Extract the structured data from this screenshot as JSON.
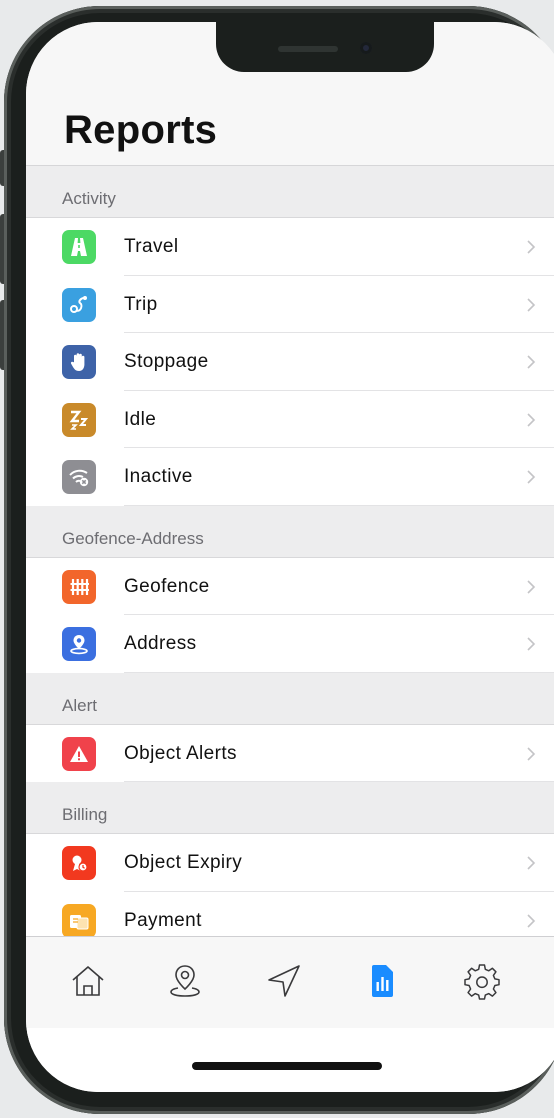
{
  "page": {
    "title": "Reports"
  },
  "sections": [
    {
      "title": "Activity",
      "items": [
        {
          "label": "Travel",
          "icon": "road-icon",
          "color": "#4cd964"
        },
        {
          "label": "Trip",
          "icon": "route-icon",
          "color": "#3aa0e0"
        },
        {
          "label": "Stoppage",
          "icon": "hand-icon",
          "color": "#3e63a8"
        },
        {
          "label": "Idle",
          "icon": "sleep-icon",
          "color": "#c98a2a"
        },
        {
          "label": "Inactive",
          "icon": "wifi-off-icon",
          "color": "#8e8e93"
        }
      ]
    },
    {
      "title": "Geofence-Address",
      "items": [
        {
          "label": "Geofence",
          "icon": "fence-icon",
          "color": "#f2662b"
        },
        {
          "label": "Address",
          "icon": "location-pin-icon",
          "color": "#3b6fe0"
        }
      ]
    },
    {
      "title": "Alert",
      "items": [
        {
          "label": "Object Alerts",
          "icon": "warning-icon",
          "color": "#f0424b"
        }
      ]
    },
    {
      "title": "Billing",
      "items": [
        {
          "label": "Object Expiry",
          "icon": "expiry-icon",
          "color": "#f2391f"
        },
        {
          "label": "Payment",
          "icon": "payment-icon",
          "color": "#f7a823"
        }
      ]
    }
  ],
  "tabbar": {
    "active_color": "#1a8cff",
    "inactive_color": "#3a3a3c",
    "tabs": [
      {
        "name": "home",
        "icon": "home-icon",
        "active": false
      },
      {
        "name": "location",
        "icon": "map-pin-icon",
        "active": false
      },
      {
        "name": "navigate",
        "icon": "navigation-arrow-icon",
        "active": false
      },
      {
        "name": "reports",
        "icon": "reports-icon",
        "active": true
      },
      {
        "name": "settings",
        "icon": "gear-icon",
        "active": false
      }
    ]
  }
}
